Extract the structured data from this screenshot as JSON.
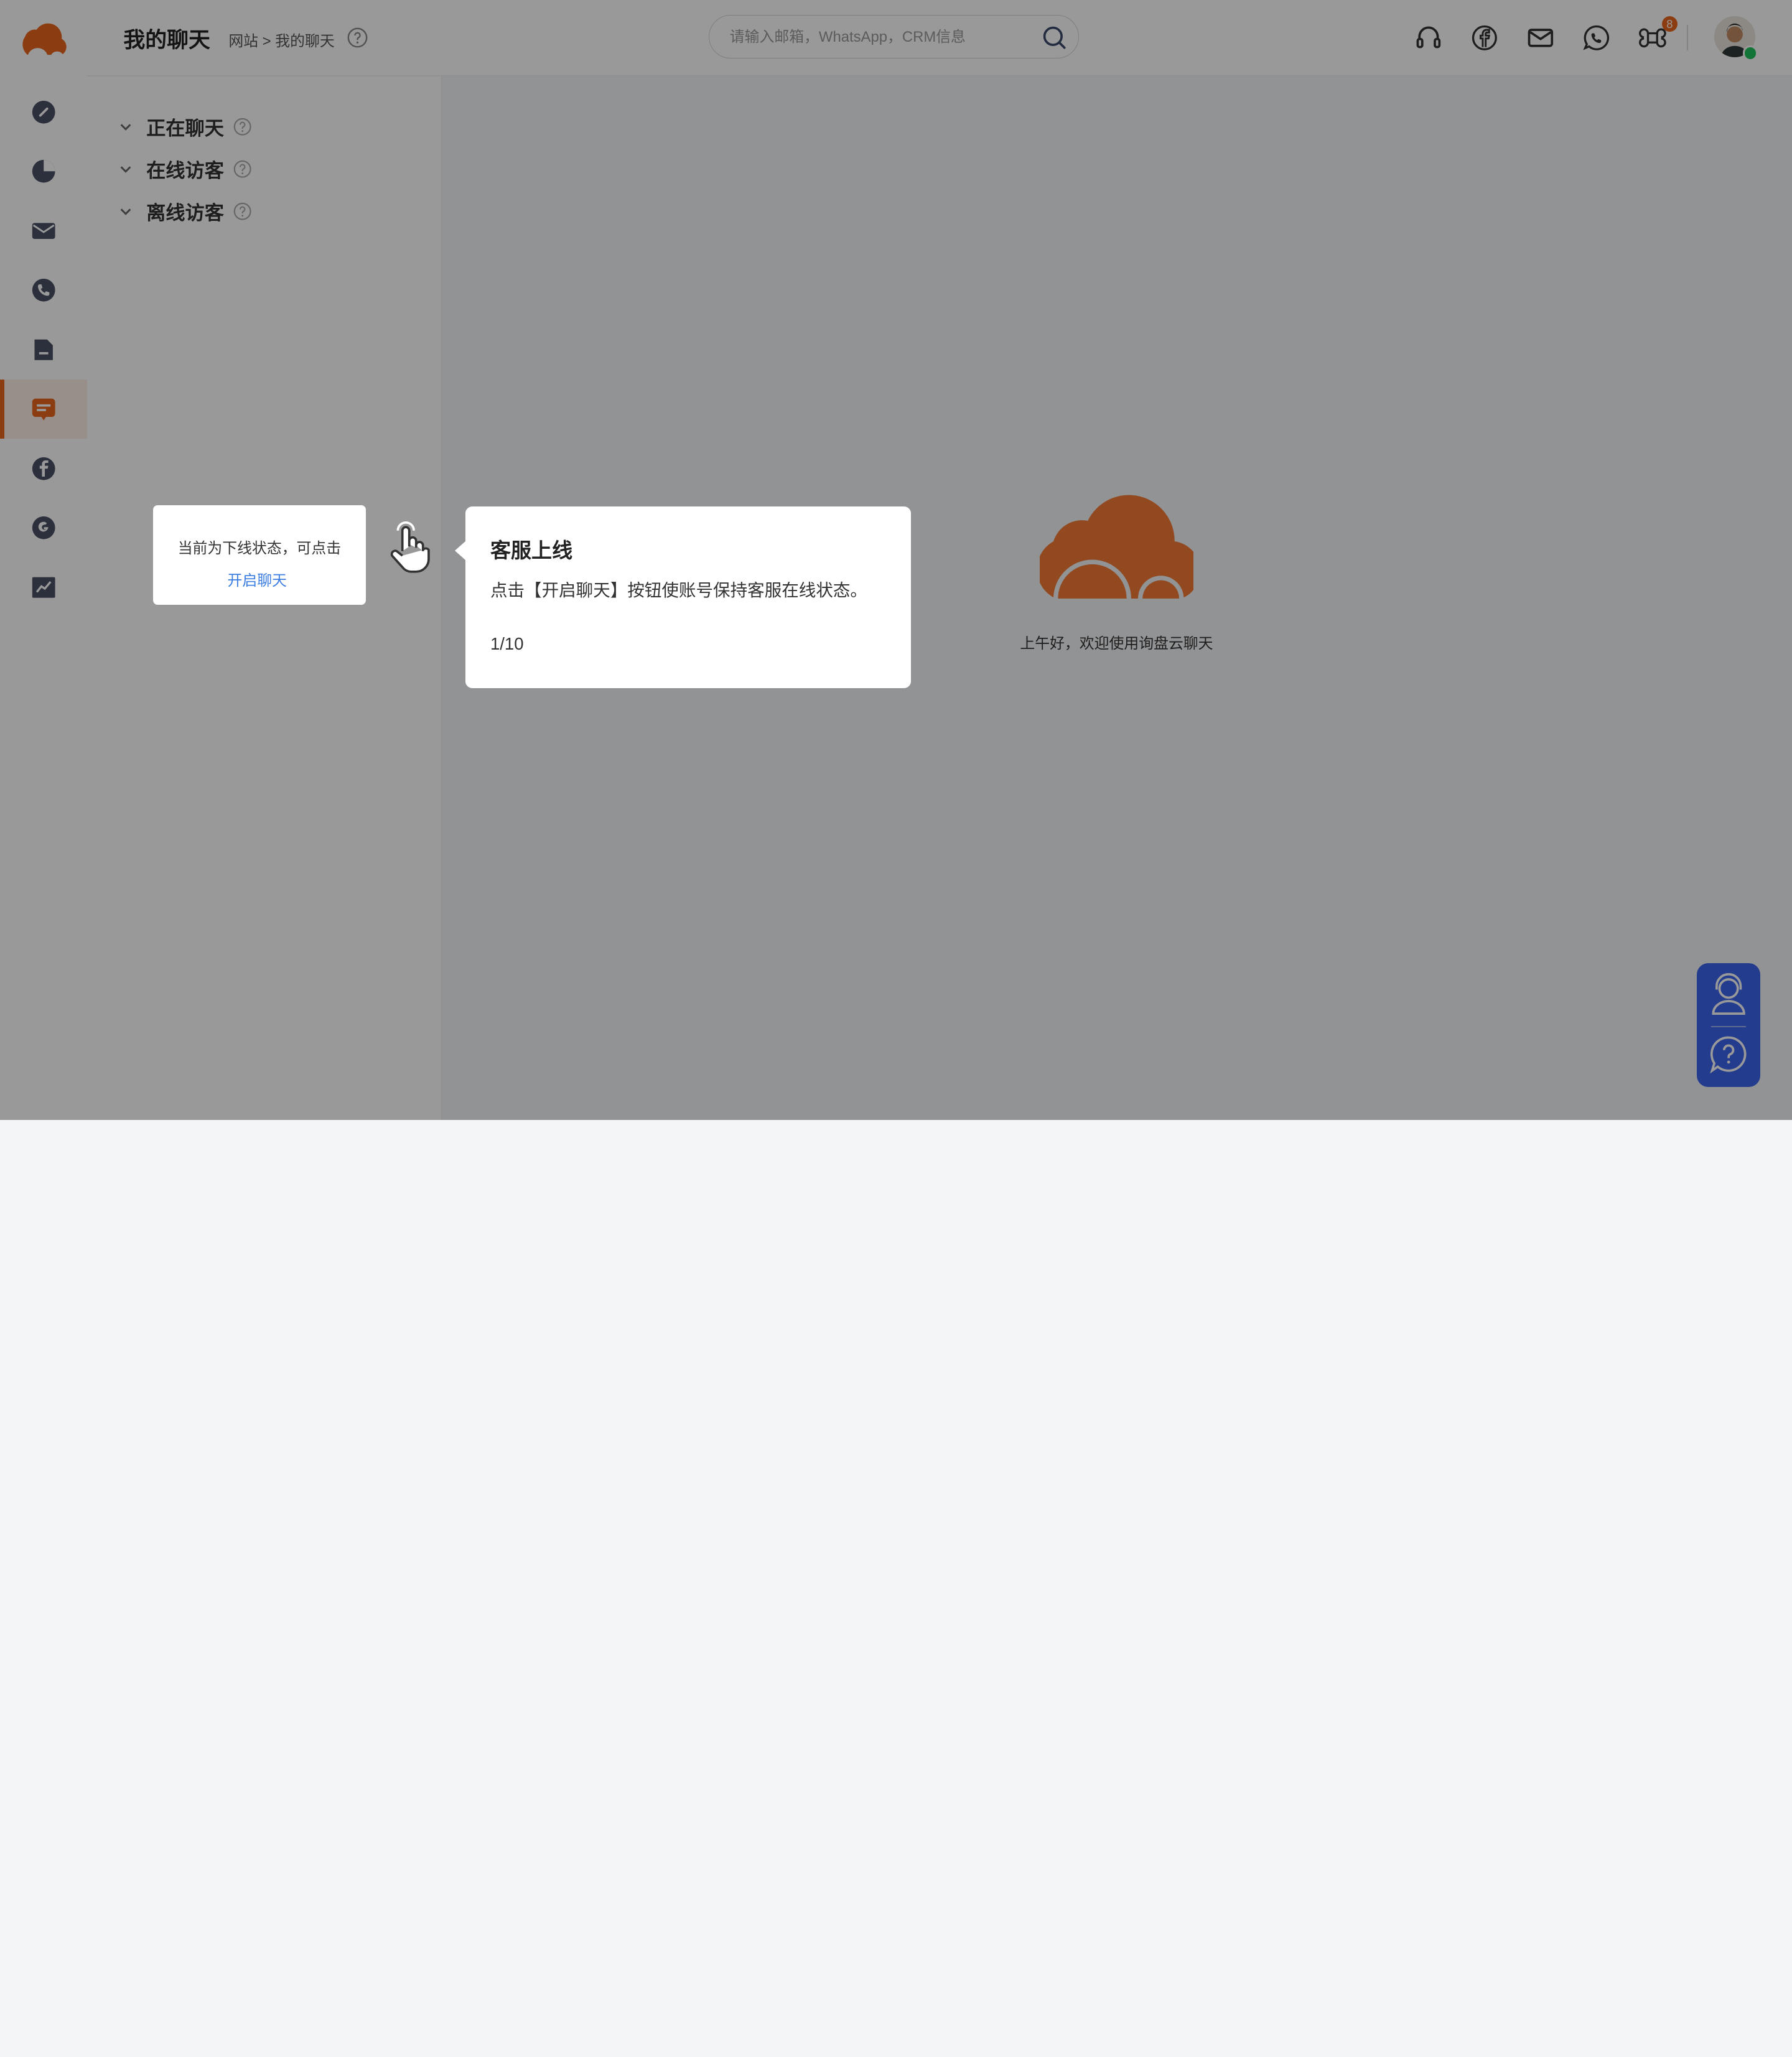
{
  "header": {
    "page_title": "我的聊天",
    "breadcrumb": "网站 > 我的聊天",
    "search_placeholder": "请输入邮箱，WhatsApp，CRM信息",
    "apps_badge": "8"
  },
  "sidebar": {
    "items": [
      {
        "icon": "dashboard-icon"
      },
      {
        "icon": "pie-chart-icon"
      },
      {
        "icon": "mail-icon"
      },
      {
        "icon": "phone-icon"
      },
      {
        "icon": "document-icon"
      },
      {
        "icon": "chat-icon",
        "active": true
      },
      {
        "icon": "facebook-icon"
      },
      {
        "icon": "google-icon"
      },
      {
        "icon": "trend-chart-icon"
      }
    ]
  },
  "list_panel": {
    "groups": [
      {
        "label": "正在聊天"
      },
      {
        "label": "在线访客"
      },
      {
        "label": "离线访客"
      }
    ]
  },
  "main": {
    "welcome_text": "上午好，欢迎使用询盘云聊天"
  },
  "guide": {
    "spotlight_text": "当前为下线状态，可点击",
    "spotlight_link": "开启聊天",
    "title": "客服上线",
    "description": "点击【开启聊天】按钮使账号保持客服在线状态。",
    "step": "1/10"
  },
  "colors": {
    "brand": "#e8641b",
    "link": "#3b7de0",
    "widget": "#3d64ec",
    "online": "#21c25e"
  }
}
